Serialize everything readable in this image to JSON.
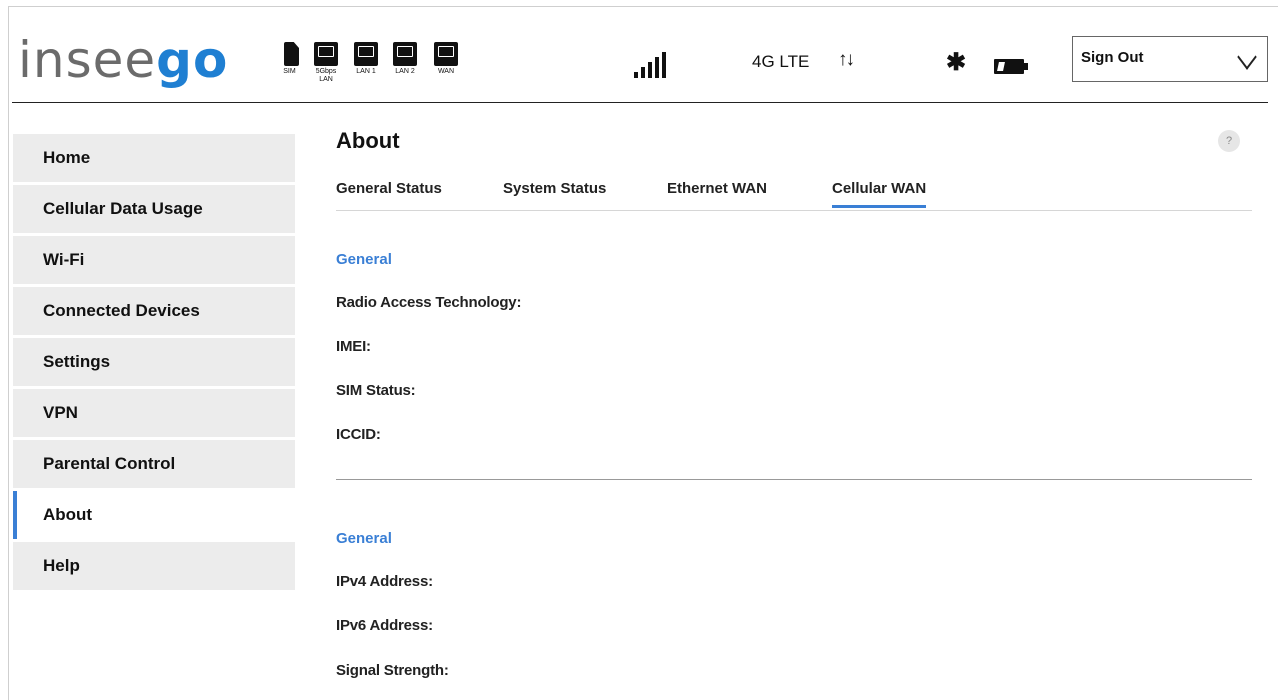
{
  "header": {
    "logo_light": "insee",
    "logo_bold": "go",
    "ports": [
      {
        "label": "SIM"
      },
      {
        "label": "5Gbps LAN"
      },
      {
        "label": "LAN 1"
      },
      {
        "label": "LAN 2"
      },
      {
        "label": "WAN"
      }
    ],
    "network_type": "4G LTE",
    "data_arrows": "↑↓",
    "bluetooth_glyph": "✱",
    "signout": "Sign Out"
  },
  "sidebar": {
    "items": [
      {
        "label": "Home"
      },
      {
        "label": "Cellular Data Usage"
      },
      {
        "label": "Wi-Fi"
      },
      {
        "label": "Connected Devices"
      },
      {
        "label": "Settings"
      },
      {
        "label": "VPN"
      },
      {
        "label": "Parental Control"
      },
      {
        "label": "About"
      },
      {
        "label": "Help"
      }
    ],
    "active": "About"
  },
  "main": {
    "title": "About",
    "help_glyph": "?",
    "tabs": [
      {
        "label": "General Status"
      },
      {
        "label": "System Status"
      },
      {
        "label": "Ethernet WAN"
      },
      {
        "label": "Cellular WAN"
      }
    ],
    "active_tab": "Cellular WAN",
    "section1": {
      "heading": "General",
      "fields": [
        "Radio Access Technology:",
        "IMEI:",
        "SIM Status:",
        "ICCID:"
      ]
    },
    "section2": {
      "heading": "General",
      "fields": [
        "IPv4 Address:",
        "IPv6 Address:",
        "Signal Strength:"
      ]
    }
  },
  "colors": {
    "accent": "#3a7fd5",
    "logo_blue": "#1f7fd2",
    "nav_bg": "#ececec"
  }
}
